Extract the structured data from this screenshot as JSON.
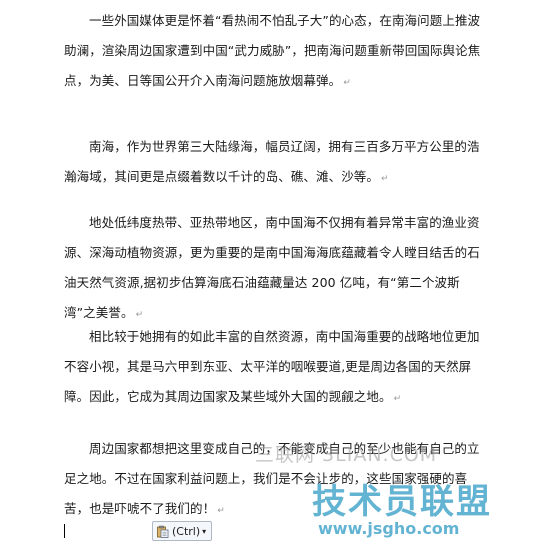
{
  "paragraphs": [
    {
      "text": "一些外国媒体更是怀着“看热闹不怕乱子大”的心态，在南海问题上推波助澜，渲染周边国家遭到中国“武力威胁”，把南海问题重新带回国际舆论焦点，为美、日等国公开介入南海问题施放烟幕弹。"
    },
    {
      "text": "南海，作为世界第三大陆缘海，幅员辽阔，拥有三百多万平方公里的浩瀚海域，其间更是点缀着数以千计的岛、礁、滩、沙等。"
    },
    {
      "text": "地处低纬度热带、亚热带地区，南中国海不仅拥有着异常丰富的渔业资源、深海动植物资源，更为重要的是南中国海海底蕴藏着令人瞠目结舌的石油天然气资源,据初步估算海底石油蕴藏量达 200 亿吨，有“第二个波斯湾”之美誉。"
    },
    {
      "text": "相比较于她拥有的如此丰富的自然资源，南中国海重要的战略地位更加不容小视，其是马六甲到东亚、太平洋的咽喉要道,更是周边各国的天然屏障。因此，它成为其周边国家及某些域外大国的觊觎之地。"
    },
    {
      "text": "周边国家都想把这里变成自己的，不能变成自己的至少也能有自己的立足之地。不过在国家利益问题上，我们是不会让步的，这些国家强硬的喜苦，也是吓唬不了我们的！"
    }
  ],
  "paragraph_mark": "↵",
  "paste_options": {
    "label": "(Ctrl)",
    "icon": "clipboard-icon",
    "caret": "▾"
  },
  "watermarks": {
    "site": "三联网 3LIAN.COM",
    "logo": "技术员联盟",
    "url": "www.jsgho.com"
  }
}
